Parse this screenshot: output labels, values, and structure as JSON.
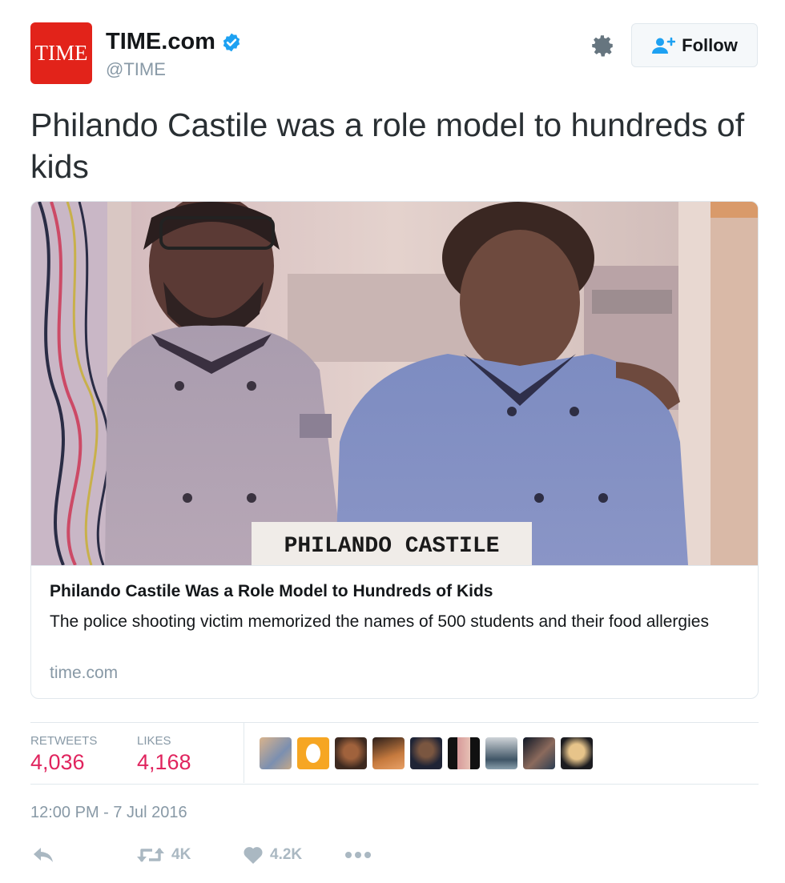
{
  "account": {
    "logo_text": "TIME",
    "display_name": "TIME.com",
    "handle": "@TIME",
    "brand_color": "#e2231a",
    "verified_color": "#1da1f2"
  },
  "header": {
    "follow_label": "Follow",
    "gear_icon": "gear-icon",
    "follow_icon": "add-user-icon"
  },
  "tweet": {
    "text": "Philando Castile was a role model to hundreds of kids"
  },
  "card": {
    "image_caption": "PHILANDO CASTILE",
    "title": "Philando Castile Was a Role Model to Hundreds of Kids",
    "description": "The police shooting victim memorized the names of 500 students and their food allergies",
    "domain": "time.com"
  },
  "stats": {
    "retweets_label": "RETWEETS",
    "retweets_value": "4,036",
    "likes_label": "LIKES",
    "likes_value": "4,168",
    "accent_color": "#e0245e",
    "avatar_count": 9
  },
  "timestamp": "12:00 PM - 7 Jul 2016",
  "actions": {
    "reply_icon": "reply-icon",
    "retweet_icon": "retweet-icon",
    "retweet_count": "4K",
    "like_icon": "heart-icon",
    "like_count": "4.2K",
    "more_icon": "more-icon"
  }
}
